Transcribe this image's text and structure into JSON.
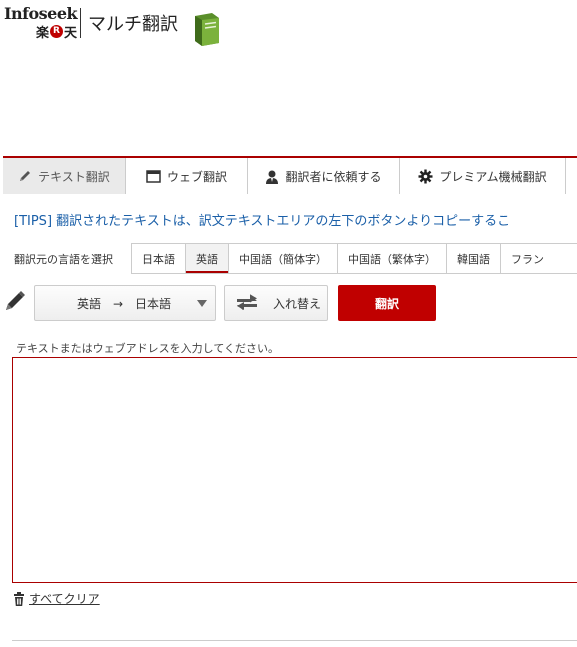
{
  "header": {
    "brand": "Infoseek",
    "rakuten_left": "楽",
    "rakuten_r": "R",
    "rakuten_right": "天",
    "title": "マルチ翻訳"
  },
  "tabs": [
    {
      "label": "テキスト翻訳",
      "icon": "pencil-icon",
      "active": true
    },
    {
      "label": "ウェブ翻訳",
      "icon": "browser-window-icon",
      "active": false
    },
    {
      "label": "翻訳者に依頼する",
      "icon": "person-icon",
      "active": false
    },
    {
      "label": "プレミアム機械翻訳",
      "icon": "gear-icon",
      "active": false
    }
  ],
  "tips": "[TIPS] 翻訳されたテキストは、訳文テキストエリアの左下のボタンよりコピーするこ",
  "language": {
    "label": "翻訳元の言語を選択",
    "options": [
      "日本語",
      "英語",
      "中国語（簡体字）",
      "中国語（繁体字）",
      "韓国語",
      "フラン"
    ],
    "selected": "英語"
  },
  "controls": {
    "direction": "英語　→　日本語",
    "swap_label": "入れ替え",
    "translate_label": "翻訳"
  },
  "input": {
    "hint": "テキストまたはウェブアドレスを入力してください。",
    "value": ""
  },
  "clear_label": "すべてクリア",
  "colors": {
    "accent": "#c00000",
    "link": "#1a5fa8"
  }
}
